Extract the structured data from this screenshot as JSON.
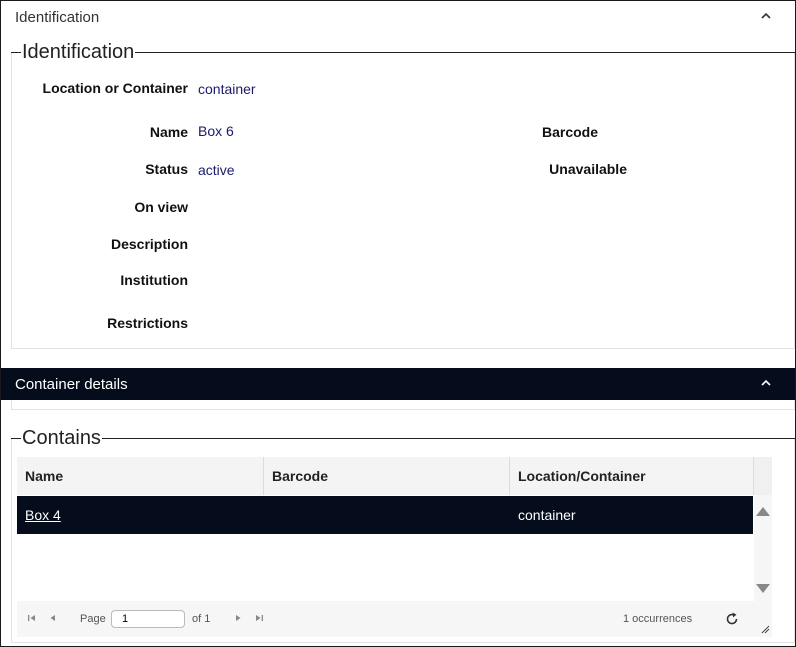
{
  "identification_section": {
    "header": "Identification",
    "legend": "Identification",
    "labels": {
      "location_or_container": "Location or Container",
      "name": "Name",
      "status": "Status",
      "on_view": "On view",
      "description": "Description",
      "institution": "Institution",
      "restrictions": "Restrictions",
      "barcode": "Barcode",
      "unavailable": "Unavailable"
    },
    "values": {
      "location_or_container": "container",
      "name": "Box 6",
      "status": "active"
    }
  },
  "container_section": {
    "header": "Container details",
    "legend": "Contains",
    "table": {
      "columns": [
        "Name",
        "Barcode",
        "Location/Container"
      ],
      "rows": [
        {
          "name": "Box 4",
          "barcode": "",
          "location": "container"
        }
      ]
    },
    "pager": {
      "page_label": "Page",
      "page_value": "1",
      "of_label": "of 1",
      "occurrences": "1 occurrences"
    }
  },
  "colors": {
    "dark_header": "#050d1c",
    "value_text": "#1a1a6e"
  },
  "icons": [
    "chevron-up-icon",
    "first-page-icon",
    "prev-page-icon",
    "next-page-icon",
    "last-page-icon",
    "refresh-icon",
    "resize-handle-icon",
    "scroll-up-icon",
    "scroll-down-icon"
  ]
}
